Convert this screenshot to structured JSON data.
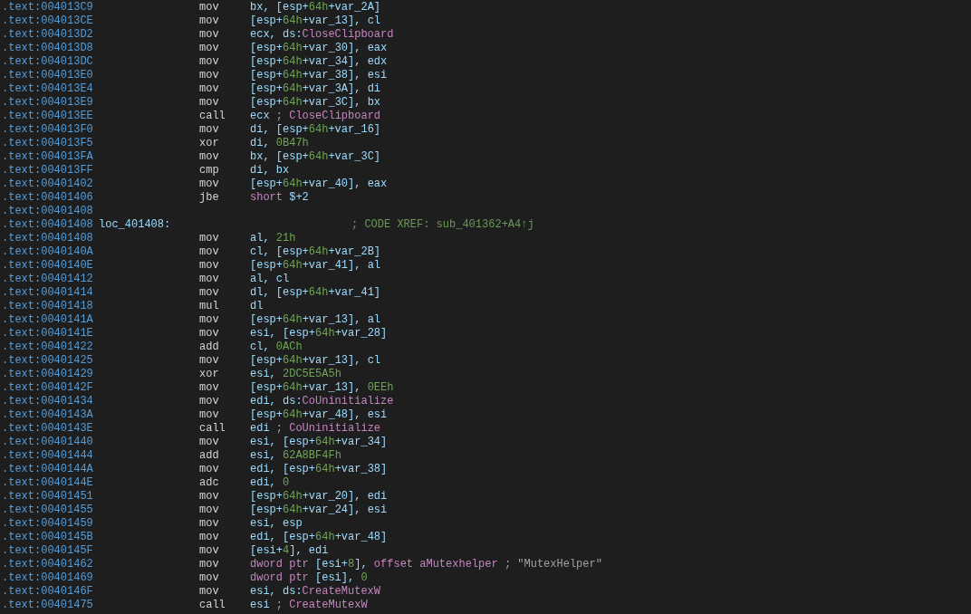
{
  "listing": {
    "lines": [
      {
        "kind": "instruction",
        "address": ".text:004013C9",
        "mnemonic": "mov",
        "operands": [
          {
            "kind": "plain",
            "text": "bx, [esp+"
          },
          {
            "kind": "num",
            "text": "64h"
          },
          {
            "kind": "plain",
            "text": "+var_2A]"
          }
        ]
      },
      {
        "kind": "instruction",
        "address": ".text:004013CE",
        "mnemonic": "mov",
        "operands": [
          {
            "kind": "plain",
            "text": "[esp+"
          },
          {
            "kind": "num",
            "text": "64h"
          },
          {
            "kind": "plain",
            "text": "+var_13], cl"
          }
        ]
      },
      {
        "kind": "instruction",
        "address": ".text:004013D2",
        "mnemonic": "mov",
        "operands": [
          {
            "kind": "plain",
            "text": "ecx, ds:"
          },
          {
            "kind": "sym",
            "text": "CloseClipboard"
          }
        ]
      },
      {
        "kind": "instruction",
        "address": ".text:004013D8",
        "mnemonic": "mov",
        "operands": [
          {
            "kind": "plain",
            "text": "[esp+"
          },
          {
            "kind": "num",
            "text": "64h"
          },
          {
            "kind": "plain",
            "text": "+var_30], eax"
          }
        ]
      },
      {
        "kind": "instruction",
        "address": ".text:004013DC",
        "mnemonic": "mov",
        "operands": [
          {
            "kind": "plain",
            "text": "[esp+"
          },
          {
            "kind": "num",
            "text": "64h"
          },
          {
            "kind": "plain",
            "text": "+var_34], edx"
          }
        ]
      },
      {
        "kind": "instruction",
        "address": ".text:004013E0",
        "mnemonic": "mov",
        "operands": [
          {
            "kind": "plain",
            "text": "[esp+"
          },
          {
            "kind": "num",
            "text": "64h"
          },
          {
            "kind": "plain",
            "text": "+var_38], esi"
          }
        ]
      },
      {
        "kind": "instruction",
        "address": ".text:004013E4",
        "mnemonic": "mov",
        "operands": [
          {
            "kind": "plain",
            "text": "[esp+"
          },
          {
            "kind": "num",
            "text": "64h"
          },
          {
            "kind": "plain",
            "text": "+var_3A], di"
          }
        ]
      },
      {
        "kind": "instruction",
        "address": ".text:004013E9",
        "mnemonic": "mov",
        "operands": [
          {
            "kind": "plain",
            "text": "[esp+"
          },
          {
            "kind": "num",
            "text": "64h"
          },
          {
            "kind": "plain",
            "text": "+var_3C], bx"
          }
        ]
      },
      {
        "kind": "instruction",
        "address": ".text:004013EE",
        "mnemonic": "call",
        "operands": [
          {
            "kind": "plain",
            "text": "ecx "
          },
          {
            "kind": "punct",
            "text": ";"
          },
          {
            "kind": "sym",
            "text": " CloseClipboard"
          }
        ]
      },
      {
        "kind": "instruction",
        "address": ".text:004013F0",
        "mnemonic": "mov",
        "operands": [
          {
            "kind": "plain",
            "text": "di, [esp+"
          },
          {
            "kind": "num",
            "text": "64h"
          },
          {
            "kind": "plain",
            "text": "+var_16]"
          }
        ]
      },
      {
        "kind": "instruction",
        "address": ".text:004013F5",
        "mnemonic": "xor",
        "operands": [
          {
            "kind": "plain",
            "text": "di, "
          },
          {
            "kind": "num",
            "text": "0B47h"
          }
        ]
      },
      {
        "kind": "instruction",
        "address": ".text:004013FA",
        "mnemonic": "mov",
        "operands": [
          {
            "kind": "plain",
            "text": "bx, [esp+"
          },
          {
            "kind": "num",
            "text": "64h"
          },
          {
            "kind": "plain",
            "text": "+var_3C]"
          }
        ]
      },
      {
        "kind": "instruction",
        "address": ".text:004013FF",
        "mnemonic": "cmp",
        "operands": [
          {
            "kind": "plain",
            "text": "di, bx"
          }
        ]
      },
      {
        "kind": "instruction",
        "address": ".text:00401402",
        "mnemonic": "mov",
        "operands": [
          {
            "kind": "plain",
            "text": "[esp+"
          },
          {
            "kind": "num",
            "text": "64h"
          },
          {
            "kind": "plain",
            "text": "+var_40], eax"
          }
        ]
      },
      {
        "kind": "instruction",
        "address": ".text:00401406",
        "mnemonic": "jbe",
        "operands": [
          {
            "kind": "kw",
            "text": "short"
          },
          {
            "kind": "plain",
            "text": " $+2"
          }
        ]
      },
      {
        "kind": "blank",
        "address": ".text:00401408"
      },
      {
        "kind": "label",
        "address": ".text:00401408",
        "label": "loc_401408:",
        "comment": "; CODE XREF: sub_401362+A4↑j"
      },
      {
        "kind": "instruction",
        "address": ".text:00401408",
        "mnemonic": "mov",
        "operands": [
          {
            "kind": "plain",
            "text": "al, "
          },
          {
            "kind": "num",
            "text": "21h"
          }
        ]
      },
      {
        "kind": "instruction",
        "address": ".text:0040140A",
        "mnemonic": "mov",
        "operands": [
          {
            "kind": "plain",
            "text": "cl, [esp+"
          },
          {
            "kind": "num",
            "text": "64h"
          },
          {
            "kind": "plain",
            "text": "+var_2B]"
          }
        ]
      },
      {
        "kind": "instruction",
        "address": ".text:0040140E",
        "mnemonic": "mov",
        "operands": [
          {
            "kind": "plain",
            "text": "[esp+"
          },
          {
            "kind": "num",
            "text": "64h"
          },
          {
            "kind": "plain",
            "text": "+var_41], al"
          }
        ]
      },
      {
        "kind": "instruction",
        "address": ".text:00401412",
        "mnemonic": "mov",
        "operands": [
          {
            "kind": "plain",
            "text": "al, cl"
          }
        ]
      },
      {
        "kind": "instruction",
        "address": ".text:00401414",
        "mnemonic": "mov",
        "operands": [
          {
            "kind": "plain",
            "text": "dl, [esp+"
          },
          {
            "kind": "num",
            "text": "64h"
          },
          {
            "kind": "plain",
            "text": "+var_41]"
          }
        ]
      },
      {
        "kind": "instruction",
        "address": ".text:00401418",
        "mnemonic": "mul",
        "operands": [
          {
            "kind": "plain",
            "text": "dl"
          }
        ]
      },
      {
        "kind": "instruction",
        "address": ".text:0040141A",
        "mnemonic": "mov",
        "operands": [
          {
            "kind": "plain",
            "text": "[esp+"
          },
          {
            "kind": "num",
            "text": "64h"
          },
          {
            "kind": "plain",
            "text": "+var_13], al"
          }
        ]
      },
      {
        "kind": "instruction",
        "address": ".text:0040141E",
        "mnemonic": "mov",
        "operands": [
          {
            "kind": "plain",
            "text": "esi, [esp+"
          },
          {
            "kind": "num",
            "text": "64h"
          },
          {
            "kind": "plain",
            "text": "+var_28]"
          }
        ]
      },
      {
        "kind": "instruction",
        "address": ".text:00401422",
        "mnemonic": "add",
        "operands": [
          {
            "kind": "plain",
            "text": "cl, "
          },
          {
            "kind": "num",
            "text": "0ACh"
          }
        ]
      },
      {
        "kind": "instruction",
        "address": ".text:00401425",
        "mnemonic": "mov",
        "operands": [
          {
            "kind": "plain",
            "text": "[esp+"
          },
          {
            "kind": "num",
            "text": "64h"
          },
          {
            "kind": "plain",
            "text": "+var_13], cl"
          }
        ]
      },
      {
        "kind": "instruction",
        "address": ".text:00401429",
        "mnemonic": "xor",
        "operands": [
          {
            "kind": "plain",
            "text": "esi, "
          },
          {
            "kind": "num",
            "text": "2DC5E5A5h"
          }
        ]
      },
      {
        "kind": "instruction",
        "address": ".text:0040142F",
        "mnemonic": "mov",
        "operands": [
          {
            "kind": "plain",
            "text": "[esp+"
          },
          {
            "kind": "num",
            "text": "64h"
          },
          {
            "kind": "plain",
            "text": "+var_13], "
          },
          {
            "kind": "num",
            "text": "0EEh"
          }
        ]
      },
      {
        "kind": "instruction",
        "address": ".text:00401434",
        "mnemonic": "mov",
        "operands": [
          {
            "kind": "plain",
            "text": "edi, ds:"
          },
          {
            "kind": "sym",
            "text": "CoUninitialize"
          }
        ]
      },
      {
        "kind": "instruction",
        "address": ".text:0040143A",
        "mnemonic": "mov",
        "operands": [
          {
            "kind": "plain",
            "text": "[esp+"
          },
          {
            "kind": "num",
            "text": "64h"
          },
          {
            "kind": "plain",
            "text": "+var_48], esi"
          }
        ]
      },
      {
        "kind": "instruction",
        "address": ".text:0040143E",
        "mnemonic": "call",
        "operands": [
          {
            "kind": "plain",
            "text": "edi "
          },
          {
            "kind": "punct",
            "text": ";"
          },
          {
            "kind": "sym",
            "text": " CoUninitialize"
          }
        ]
      },
      {
        "kind": "instruction",
        "address": ".text:00401440",
        "mnemonic": "mov",
        "operands": [
          {
            "kind": "plain",
            "text": "esi, [esp+"
          },
          {
            "kind": "num",
            "text": "64h"
          },
          {
            "kind": "plain",
            "text": "+var_34]"
          }
        ]
      },
      {
        "kind": "instruction",
        "address": ".text:00401444",
        "mnemonic": "add",
        "operands": [
          {
            "kind": "plain",
            "text": "esi, "
          },
          {
            "kind": "num",
            "text": "62A8BF4Fh"
          }
        ]
      },
      {
        "kind": "instruction",
        "address": ".text:0040144A",
        "mnemonic": "mov",
        "operands": [
          {
            "kind": "plain",
            "text": "edi, [esp+"
          },
          {
            "kind": "num",
            "text": "64h"
          },
          {
            "kind": "plain",
            "text": "+var_38]"
          }
        ]
      },
      {
        "kind": "instruction",
        "address": ".text:0040144E",
        "mnemonic": "adc",
        "operands": [
          {
            "kind": "plain",
            "text": "edi, "
          },
          {
            "kind": "num",
            "text": "0"
          }
        ]
      },
      {
        "kind": "instruction",
        "address": ".text:00401451",
        "mnemonic": "mov",
        "operands": [
          {
            "kind": "plain",
            "text": "[esp+"
          },
          {
            "kind": "num",
            "text": "64h"
          },
          {
            "kind": "plain",
            "text": "+var_20], edi"
          }
        ]
      },
      {
        "kind": "instruction",
        "address": ".text:00401455",
        "mnemonic": "mov",
        "operands": [
          {
            "kind": "plain",
            "text": "[esp+"
          },
          {
            "kind": "num",
            "text": "64h"
          },
          {
            "kind": "plain",
            "text": "+var_24], esi"
          }
        ]
      },
      {
        "kind": "instruction",
        "address": ".text:00401459",
        "mnemonic": "mov",
        "operands": [
          {
            "kind": "plain",
            "text": "esi, esp"
          }
        ]
      },
      {
        "kind": "instruction",
        "address": ".text:0040145B",
        "mnemonic": "mov",
        "operands": [
          {
            "kind": "plain",
            "text": "edi, [esp+"
          },
          {
            "kind": "num",
            "text": "64h"
          },
          {
            "kind": "plain",
            "text": "+var_48]"
          }
        ]
      },
      {
        "kind": "instruction",
        "address": ".text:0040145F",
        "mnemonic": "mov",
        "operands": [
          {
            "kind": "plain",
            "text": "[esi+"
          },
          {
            "kind": "num",
            "text": "4"
          },
          {
            "kind": "plain",
            "text": "], edi"
          }
        ]
      },
      {
        "kind": "instruction",
        "address": ".text:00401462",
        "mnemonic": "mov",
        "operands": [
          {
            "kind": "kw",
            "text": "dword ptr"
          },
          {
            "kind": "plain",
            "text": " [esi+"
          },
          {
            "kind": "num",
            "text": "8"
          },
          {
            "kind": "plain",
            "text": "], "
          },
          {
            "kind": "kw",
            "text": "offset"
          },
          {
            "kind": "sym",
            "text": " aMutexhelper"
          },
          {
            "kind": "punct",
            "text": " ;"
          },
          {
            "kind": "str",
            "text": " \"MutexHelper\""
          }
        ]
      },
      {
        "kind": "instruction",
        "address": ".text:00401469",
        "mnemonic": "mov",
        "operands": [
          {
            "kind": "kw",
            "text": "dword ptr"
          },
          {
            "kind": "plain",
            "text": " [esi], "
          },
          {
            "kind": "num",
            "text": "0"
          }
        ]
      },
      {
        "kind": "instruction",
        "address": ".text:0040146F",
        "mnemonic": "mov",
        "operands": [
          {
            "kind": "plain",
            "text": "esi, ds:"
          },
          {
            "kind": "sym",
            "text": "CreateMutexW"
          }
        ]
      },
      {
        "kind": "instruction",
        "address": ".text:00401475",
        "mnemonic": "call",
        "operands": [
          {
            "kind": "plain",
            "text": "esi "
          },
          {
            "kind": "punct",
            "text": ";"
          },
          {
            "kind": "sym",
            "text": " CreateMutexW"
          }
        ]
      }
    ]
  }
}
